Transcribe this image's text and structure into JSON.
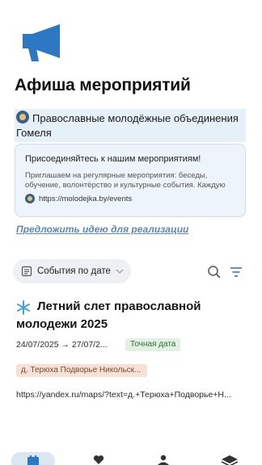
{
  "page": {
    "title": "Афиша мероприятий"
  },
  "organization": {
    "name": "Православные молодёжные объединения Гомеля"
  },
  "invite_card": {
    "title": "Присоединяйтесь к нашим мероприятиям!",
    "text": "Приглашаем на регулярные мероприятия: беседы, обучение, волонтёрство и культурные события. Каждую",
    "link": "https://molodejka.by/events"
  },
  "suggest_idea": {
    "label": "Предложить идею для реализации"
  },
  "filters": {
    "sort_label": "События по дате"
  },
  "events": [
    {
      "title": "Летний слет православной молодежи 2025",
      "dates": "24/07/2025 → 27/07/2...",
      "date_type": "Точная дата",
      "place": "д. Терюха Подворье Никольск...",
      "map_link": "https://yandex.ru/maps/?text=д.+Терюха+Подворье+Н..."
    }
  ],
  "bottom_nav": {
    "items": [
      "calendar-icon",
      "heart-icon",
      "person-icon",
      "layers-icon"
    ],
    "active": "calendar-icon"
  },
  "colors": {
    "accent": "#2d78c2",
    "link": "#5e88b3",
    "org_bg": "#e6f0f9",
    "card_bg": "#eef4fb",
    "date_badge_bg": "#e3f1e4",
    "place_badge_bg": "#f7e1d6"
  }
}
